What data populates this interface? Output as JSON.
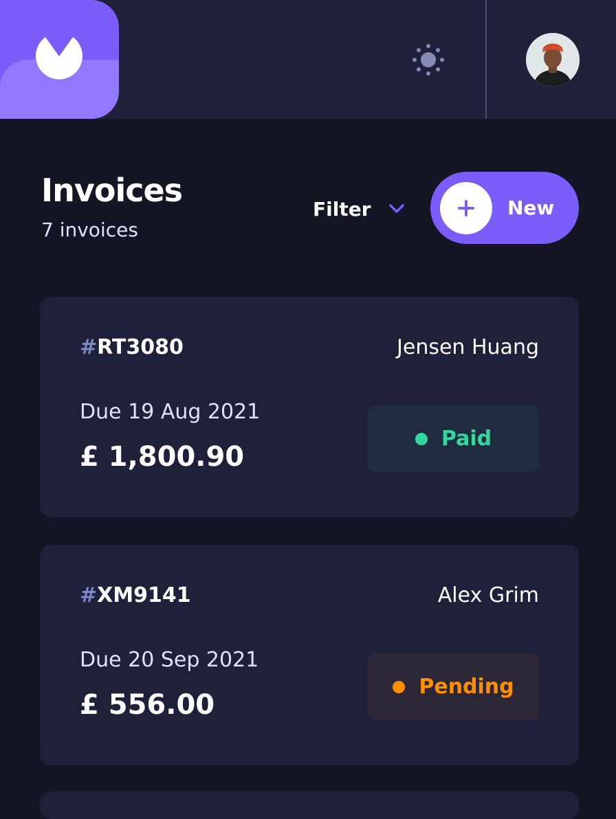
{
  "header": {
    "logo_icon": "logo-icon",
    "theme_icon": "sun-icon",
    "avatar_alt": "user-avatar"
  },
  "main": {
    "title": "Invoices",
    "count_text": "7 invoices",
    "filter_label": "Filter",
    "new_label": "New"
  },
  "invoices": [
    {
      "hash": "#",
      "id": "RT3080",
      "client": "Jensen Huang",
      "due": "Due  19 Aug 2021",
      "amount": "£ 1,800.90",
      "status": "Paid"
    },
    {
      "hash": "#",
      "id": "XM9141",
      "client": "Alex Grim",
      "due": "Due  20 Sep 2021",
      "amount": "£ 556.00",
      "status": "Pending"
    }
  ],
  "colors": {
    "accent": "#7c5dfa",
    "paid": "#33d69f",
    "pending": "#ff8f00",
    "background": "#141625",
    "card": "#1e2139"
  }
}
